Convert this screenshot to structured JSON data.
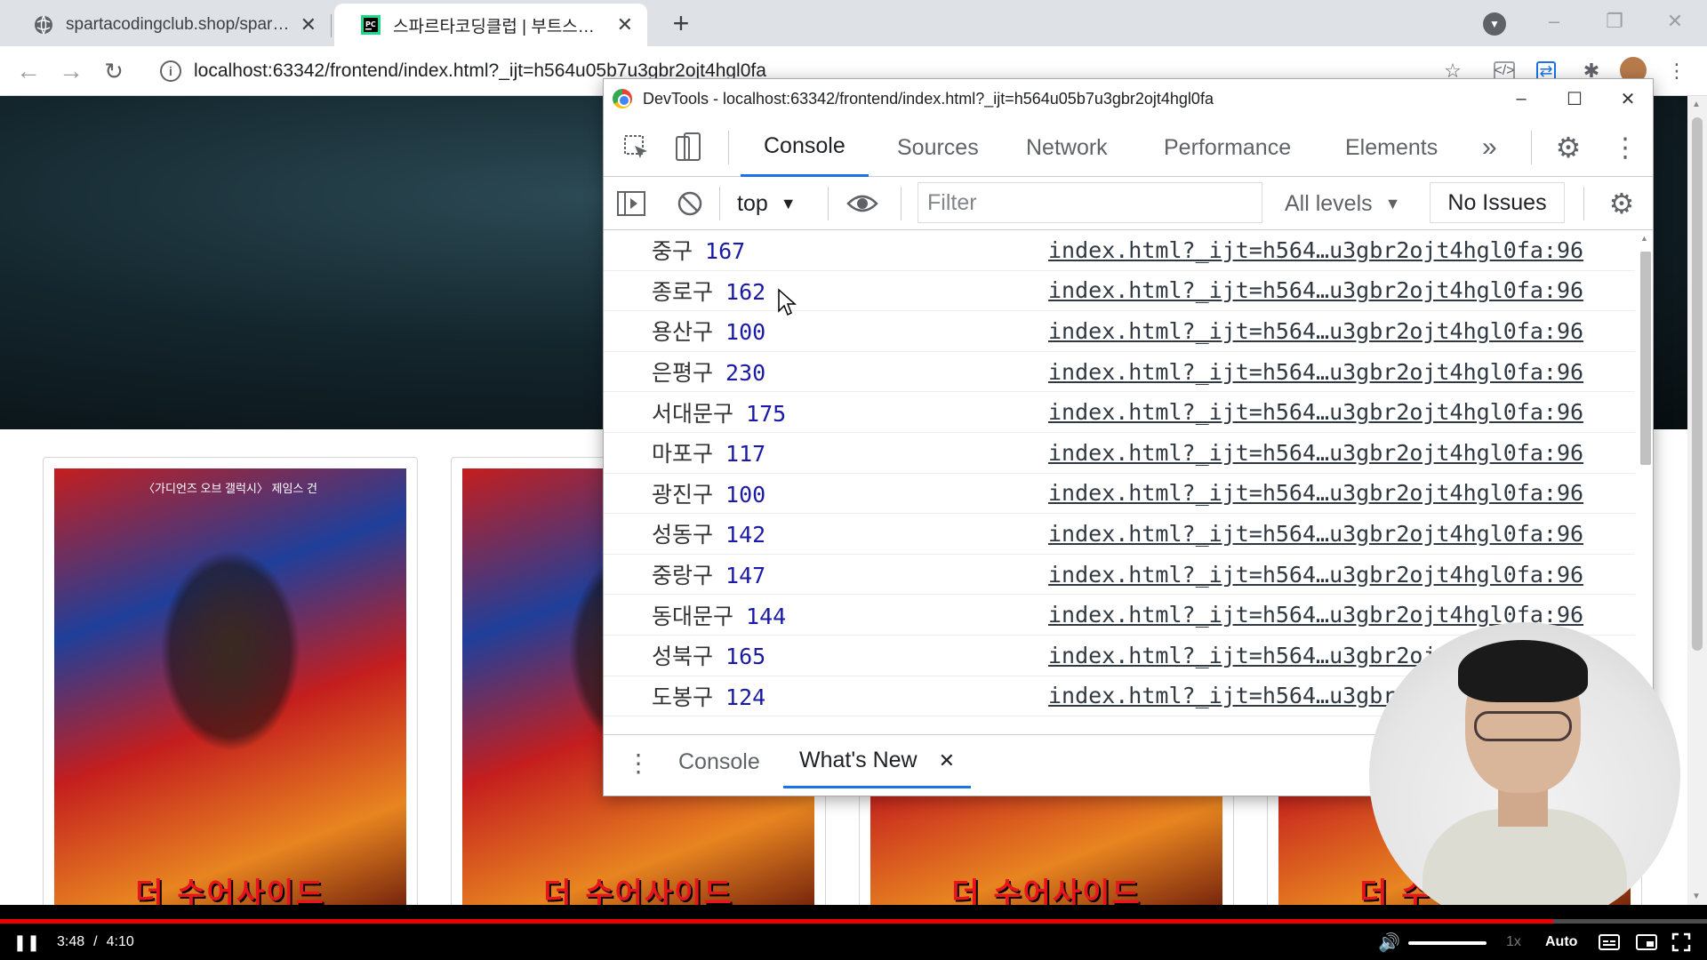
{
  "browser": {
    "tabs": [
      {
        "title": "spartacodingclub.shop/sparta_a",
        "active": false,
        "icon": "globe-icon"
      },
      {
        "title": "스파르타코딩클럽 | 부트스트랩",
        "active": true,
        "icon": "pycharm-icon"
      }
    ],
    "new_tab_label": "+",
    "url": "localhost:63342/frontend/index.html?_ijt=h564u05b7u3gbr2ojt4hgl0fa"
  },
  "page": {
    "posters": [
      {
        "credit": "〈가디언즈 오브 갤럭시〉 제임스 건",
        "logo": "더 수어사이드"
      },
      {
        "credit": "",
        "logo": "더 수어사이드"
      },
      {
        "credit": "",
        "logo": "더 수어사이드"
      },
      {
        "credit": "",
        "logo": "더 수어사이드"
      },
      {
        "credit": "",
        "logo": "더 수"
      }
    ]
  },
  "devtools": {
    "title": "DevTools - localhost:63342/frontend/index.html?_ijt=h564u05b7u3gbr2ojt4hgl0fa",
    "tabs": [
      "Console",
      "Sources",
      "Network",
      "Performance",
      "Elements"
    ],
    "selected_tab": "Console",
    "more_tabs_label": "»",
    "context_select": "top",
    "filter_placeholder": "Filter",
    "levels_select": "All levels",
    "issues_label": "No Issues",
    "log_source": "index.html?_ijt=h564…u3gbr2ojt4hgl0fa:96",
    "log_rows": [
      {
        "name": "중구",
        "value": "167"
      },
      {
        "name": "종로구",
        "value": "162"
      },
      {
        "name": "용산구",
        "value": "100"
      },
      {
        "name": "은평구",
        "value": "230"
      },
      {
        "name": "서대문구",
        "value": "175"
      },
      {
        "name": "마포구",
        "value": "117"
      },
      {
        "name": "광진구",
        "value": "100"
      },
      {
        "name": "성동구",
        "value": "142"
      },
      {
        "name": "중랑구",
        "value": "147"
      },
      {
        "name": "동대문구",
        "value": "144"
      },
      {
        "name": "성북구",
        "value": "165"
      },
      {
        "name": "도봉구",
        "value": "124"
      }
    ],
    "drawer_tabs": [
      {
        "label": "Console",
        "selected": false
      },
      {
        "label": "What's New",
        "selected": true
      }
    ]
  },
  "player": {
    "current_time": "3:48",
    "separator": "/",
    "duration": "4:10",
    "progress": 0.91,
    "volume": 1.0,
    "speed": "1x",
    "quality": "Auto"
  },
  "colors": {
    "accent": "#1a73e8",
    "log_number": "#1a1aa6",
    "progress": "#ee0000"
  }
}
